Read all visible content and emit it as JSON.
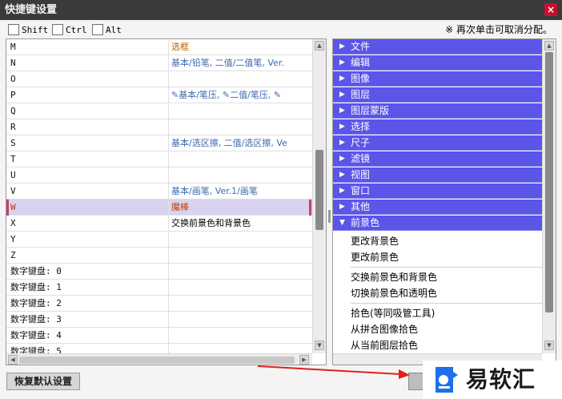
{
  "window": {
    "title": "快捷键设置",
    "close": "×"
  },
  "modifiers": [
    {
      "label": "Shift"
    },
    {
      "label": "Ctrl"
    },
    {
      "label": "Alt"
    }
  ],
  "hint": "※ 再次单击可取消分配。",
  "shortcut_rows": [
    {
      "key": "M",
      "value": "选框",
      "style": "orange"
    },
    {
      "key": "N",
      "value": "基本/铅笔, 二值/二值笔, Ver.",
      "style": "blue"
    },
    {
      "key": "O",
      "value": "",
      "style": "blue"
    },
    {
      "key": "P",
      "value": "✎基本/笔压, ✎二值/笔压, ✎",
      "style": "blue"
    },
    {
      "key": "Q",
      "value": "",
      "style": "blue"
    },
    {
      "key": "R",
      "value": "",
      "style": "blue"
    },
    {
      "key": "S",
      "value": "基本/选区擦, 二值/选区擦, Ve",
      "style": "blue"
    },
    {
      "key": "T",
      "value": "",
      "style": "blue"
    },
    {
      "key": "U",
      "value": "",
      "style": "blue"
    },
    {
      "key": "V",
      "value": "基本/画笔, Ver.1/画笔",
      "style": "blue"
    },
    {
      "key": "W",
      "value": "魔棒",
      "style": "orange",
      "selected": true
    },
    {
      "key": "X",
      "value": "交换前景色和背景色",
      "style": "black"
    },
    {
      "key": "Y",
      "value": "",
      "style": "blue"
    },
    {
      "key": "Z",
      "value": "",
      "style": "blue"
    },
    {
      "key": "数字键盘: 0",
      "value": "",
      "style": "blue"
    },
    {
      "key": "数字键盘: 1",
      "value": "",
      "style": "blue"
    },
    {
      "key": "数字键盘: 2",
      "value": "",
      "style": "blue"
    },
    {
      "key": "数字键盘: 3",
      "value": "",
      "style": "blue"
    },
    {
      "key": "数字键盘: 4",
      "value": "",
      "style": "blue"
    },
    {
      "key": "数字键盘: 5",
      "value": "",
      "style": "blue"
    }
  ],
  "command_tree": {
    "categories": [
      {
        "label": "文件",
        "expanded": false
      },
      {
        "label": "编辑",
        "expanded": false
      },
      {
        "label": "图像",
        "expanded": false
      },
      {
        "label": "图层",
        "expanded": false
      },
      {
        "label": "图层蒙版",
        "expanded": false
      },
      {
        "label": "选择",
        "expanded": false
      },
      {
        "label": "尺子",
        "expanded": false
      },
      {
        "label": "滤镜",
        "expanded": false
      },
      {
        "label": "视图",
        "expanded": false
      },
      {
        "label": "窗口",
        "expanded": false
      },
      {
        "label": "其他",
        "expanded": false
      },
      {
        "label": "前景色",
        "expanded": true
      }
    ],
    "foreground_items": [
      [
        "更改背景色",
        "更改前景色"
      ],
      [
        "交换前景色和背景色",
        "切换前景色和透明色"
      ],
      [
        "拾色(等同吸管工具)",
        "从拼合图像拾色",
        "从当前图层拾色"
      ]
    ]
  },
  "buttons": {
    "restore_default": "恢复默认设置"
  },
  "watermark": {
    "name": "易软汇"
  },
  "colors": {
    "category_bg": "#5b55e8",
    "selected_row": "#d8d3f0",
    "accent_orange": "#c06000",
    "accent_blue": "#3c6ab0",
    "arrow_red": "#e02020"
  }
}
